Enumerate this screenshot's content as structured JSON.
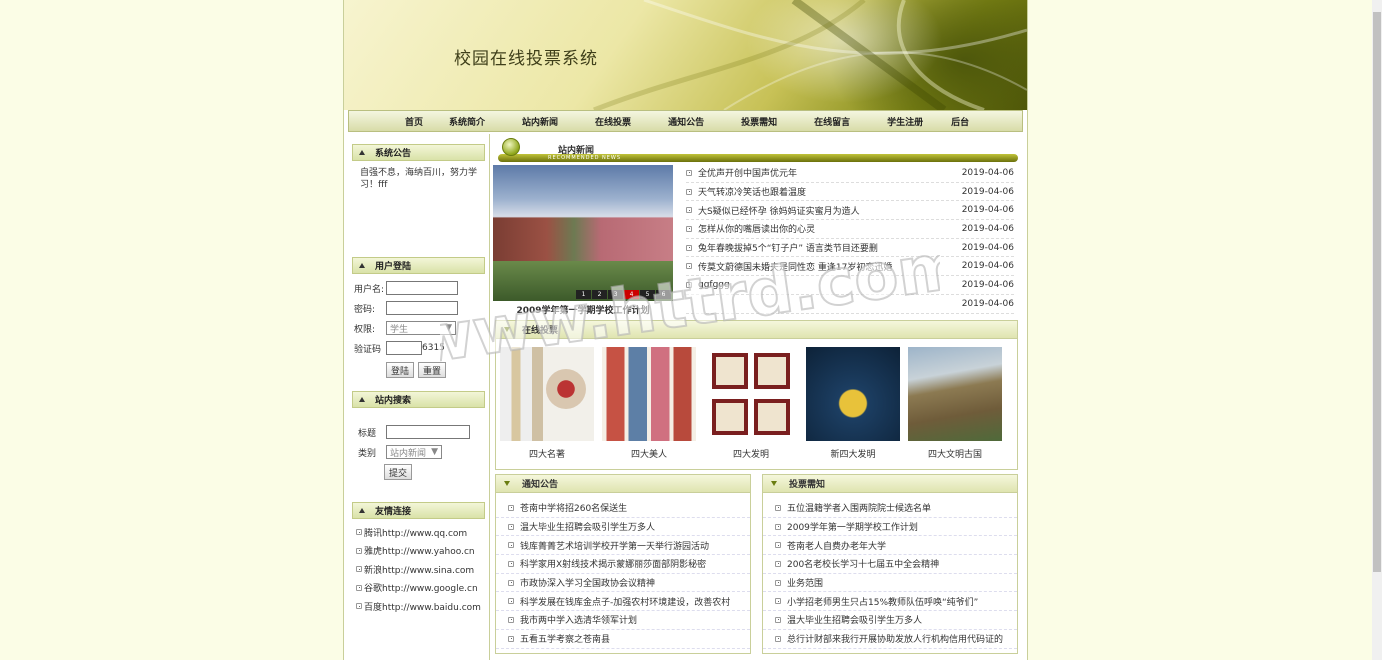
{
  "site_title": "校园在线投票系统",
  "nav": [
    "首页",
    "系统简介",
    "站内新闻",
    "在线投票",
    "通知公告",
    "投票需知",
    "在线留言",
    "学生注册",
    "后台"
  ],
  "sidebar": {
    "notice_title": "系统公告",
    "notice_text": "自强不息，海纳百川，努力学习！fff",
    "login_title": "用户登陆",
    "username_label": "用户名:",
    "password_label": "密码:",
    "role_label": "权限:",
    "role_value": "学生",
    "captcha_label": "验证码",
    "captcha_code": "6315",
    "login_button": "登陆",
    "reset_button": "重置",
    "search_title": "站内搜索",
    "search_title_label": "标题",
    "search_type_label": "类别",
    "search_type_value": "站内新闻",
    "submit_button": "提交",
    "links_title": "友情连接",
    "links": [
      "腾讯http://www.qq.com",
      "雅虎http://www.yahoo.cn",
      "新浪http://www.sina.com",
      "谷歌http://www.google.cn",
      "百度http://www.baidu.com"
    ]
  },
  "news": {
    "title": "站内新闻",
    "subtitle": "RECOMMENDED NEWS",
    "photo_caption": "2009学年第一学期学校工作计划",
    "pager": [
      "1",
      "2",
      "3",
      "4",
      "5",
      "6"
    ],
    "items": [
      {
        "title": "全优声开创中国声优元年",
        "date": "2019-04-06"
      },
      {
        "title": "天气转凉冷笑话也跟着温度",
        "date": "2019-04-06"
      },
      {
        "title": "大S疑似已经怀孕 徐妈妈证实蜜月为造人",
        "date": "2019-04-06"
      },
      {
        "title": "怎样从你的嘴唇读出你的心灵",
        "date": "2019-04-06"
      },
      {
        "title": "兔年春晚拔掉5个“钉子户” 语言类节目还要删",
        "date": "2019-04-06"
      },
      {
        "title": "传莫文蔚德国未婚夫是同性恋 重逢17岁初恋迅婚",
        "date": "2019-04-06"
      },
      {
        "title": "ggfggg",
        "date": "2019-04-06"
      },
      {
        "title": "",
        "date": "2019-04-06"
      }
    ]
  },
  "vote": {
    "title": "在线投票",
    "items": [
      "四大名著",
      "四大美人",
      "四大发明",
      "新四大发明",
      "四大文明古国"
    ]
  },
  "notices": {
    "title": "通知公告",
    "items": [
      "苍南中学将招260名保送生",
      "温大毕业生招聘会吸引学生万多人",
      "钱库菁菁艺术培训学校开学第一天举行游园活动",
      "科学家用X射线技术揭示蒙娜丽莎面部阴影秘密",
      "市政协深入学习全国政协会议精神",
      "科学发展在钱库金点子-加强农村环境建设，改善农村",
      "我市两中学入选清华领军计划",
      "五看五学考察之苍南县"
    ]
  },
  "vote_notes": {
    "title": "投票需知",
    "items": [
      "五位温籍学者入围两院院士候选名单",
      "2009学年第一学期学校工作计划",
      "苍南老人自费办老年大学",
      "200名老校长学习十七届五中全会精神",
      "业务范围",
      "小学招老师男生只占15%教师队伍呼唤“纯爷们”",
      "温大毕业生招聘会吸引学生万多人",
      "总行计财部来我行开展协助发放人行机构信用代码证的"
    ]
  },
  "watermark": "www.httrd.com"
}
